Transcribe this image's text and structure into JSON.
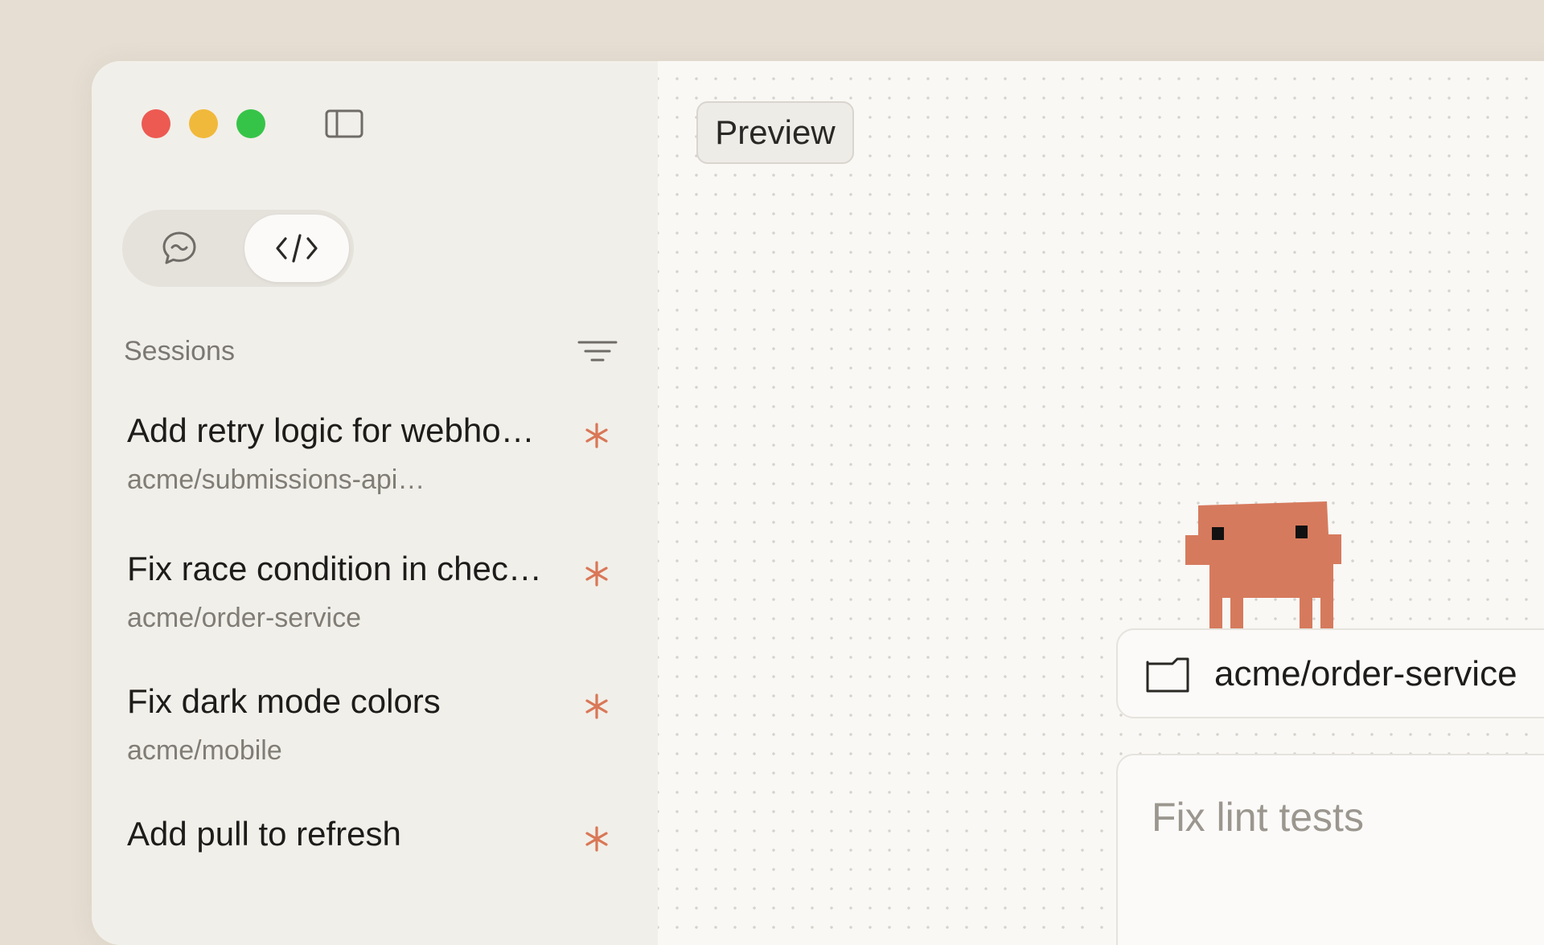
{
  "window": {
    "traffic_lights": [
      "close",
      "minimize",
      "zoom"
    ],
    "colors": {
      "close": "#ec5a52",
      "minimize": "#f1b93b",
      "zoom": "#36c448",
      "accent": "#d97757"
    }
  },
  "sidebar": {
    "toggle_icon": "sidebar-toggle-icon",
    "mode_switch": {
      "options": [
        {
          "icon": "chat-bubble-icon",
          "selected": false
        },
        {
          "icon": "code-brackets-icon",
          "selected": true
        }
      ]
    },
    "sessions_label": "Sessions",
    "filter_icon": "filter-icon",
    "sessions": [
      {
        "title": "Add retry logic for webho…",
        "repo": "acme/submissions-api…",
        "status_icon": "asterisk-icon"
      },
      {
        "title": "Fix race condition in chec…",
        "repo": "acme/order-service",
        "status_icon": "asterisk-icon"
      },
      {
        "title": "Fix dark mode colors",
        "repo": "acme/mobile",
        "status_icon": "asterisk-icon"
      },
      {
        "title": "Add pull to refresh",
        "repo": "",
        "status_icon": "asterisk-icon"
      }
    ]
  },
  "main": {
    "preview_button": "Preview",
    "mascot": "pixel-creature",
    "repo_selector": {
      "icon": "folder-icon",
      "value": "acme/order-service"
    },
    "prompt": {
      "placeholder": "Fix lint tests"
    }
  }
}
